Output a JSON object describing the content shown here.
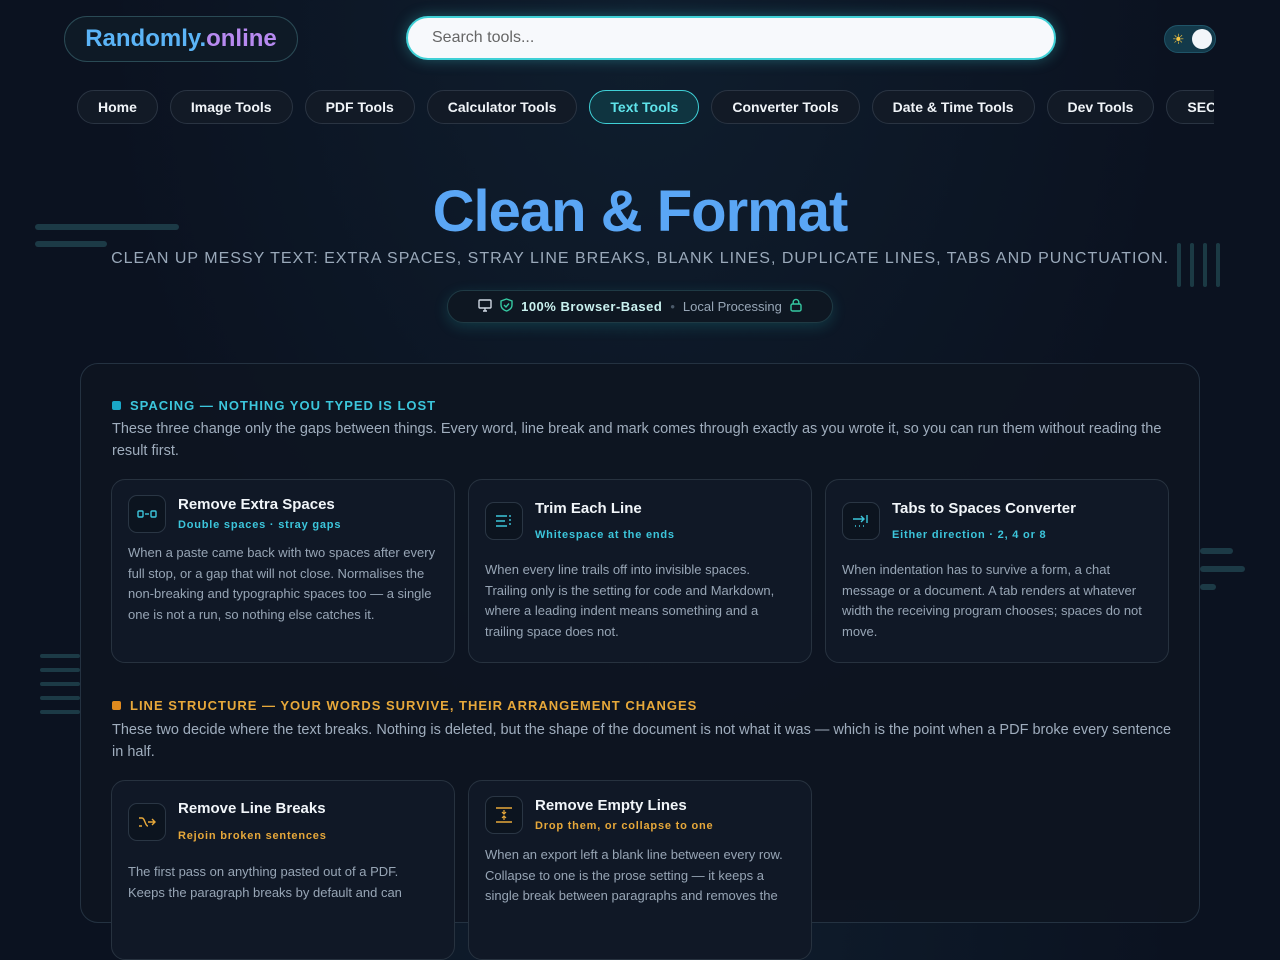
{
  "header": {
    "logo_part1": "Randomly.",
    "logo_part2": "online",
    "search_placeholder": "Search tools...",
    "theme_icon": "sun-icon"
  },
  "nav": [
    "Home",
    "Image Tools",
    "PDF Tools",
    "Calculator Tools",
    "Text Tools",
    "Converter Tools",
    "Date & Time Tools",
    "Dev Tools",
    "SEO Tools"
  ],
  "nav_active": "Text Tools",
  "hero": {
    "title": "Clean & Format",
    "subtitle": "CLEAN UP MESSY TEXT: EXTRA SPACES, STRAY LINE BREAKS, BLANK LINES, DUPLICATE LINES, TABS AND PUNCTUATION.",
    "badge_bold": "100% Browser-Based",
    "badge_sep": "•",
    "badge_text": "Local Processing"
  },
  "sections": [
    {
      "heading": "SPACING — NOTHING YOU TYPED IS LOST",
      "accent": "#3cc6dc",
      "description": "These three change only the gaps between things. Every word, line break and mark comes through exactly as you wrote it, so you can run them without reading the result first.",
      "cards": [
        {
          "title": "Remove Extra Spaces",
          "subtitle": "Double spaces · stray gaps",
          "icon": "spaces-icon",
          "description": "When a paste came back with two spaces after every full stop, or a gap that will not close. Normalises the non-breaking and typographic spaces too — a single one is not a run, so nothing else catches it."
        },
        {
          "title": "Trim Each Line",
          "subtitle": "Whitespace at the ends",
          "icon": "trim-lines-icon",
          "description": "When every line trails off into invisible spaces. Trailing only is the setting for code and Markdown, where a leading indent means something and a trailing space does not."
        },
        {
          "title": "Tabs to Spaces Converter",
          "subtitle": "Either direction · 2, 4 or 8",
          "icon": "tab-arrow-icon",
          "description": "When indentation has to survive a form, a chat message or a document. A tab renders at whatever width the receiving program chooses; spaces do not move."
        }
      ]
    },
    {
      "heading": "LINE STRUCTURE — YOUR WORDS SURVIVE, THEIR ARRANGEMENT CHANGES",
      "accent": "#e7a83a",
      "description": "These two decide where the text breaks. Nothing is deleted, but the shape of the document is not what it was — which is the point when a PDF broke every sentence in half.",
      "cards": [
        {
          "title": "Remove Line Breaks",
          "subtitle": "Rejoin broken sentences",
          "icon": "merge-lines-icon",
          "description": "The first pass on anything pasted out of a PDF. Keeps the paragraph breaks by default and can"
        },
        {
          "title": "Remove Empty Lines",
          "subtitle": "Drop them, or collapse to one",
          "icon": "collapse-lines-icon",
          "description": "When an export left a blank line between every row. Collapse to one is the prose setting — it keeps a single break between paragraphs and removes the"
        }
      ]
    }
  ]
}
